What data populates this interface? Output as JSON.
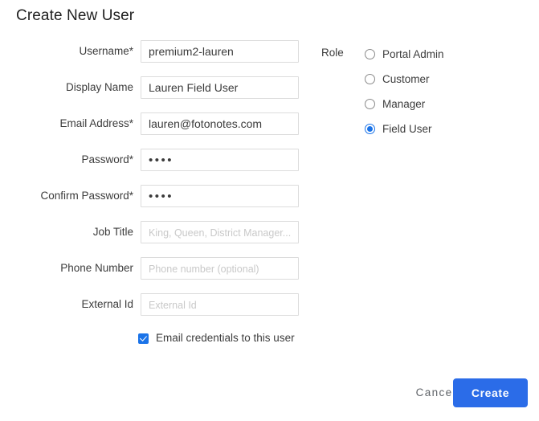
{
  "dialog": {
    "title": "Create New User"
  },
  "form": {
    "fields": [
      {
        "label": "Username*",
        "value": "premium2-lauren",
        "placeholder": "",
        "type": "text",
        "name": "username"
      },
      {
        "label": "Display Name",
        "value": "Lauren Field User",
        "placeholder": "",
        "type": "text",
        "name": "display-name"
      },
      {
        "label": "Email Address*",
        "value": "lauren@fotonotes.com",
        "placeholder": "",
        "type": "text",
        "name": "email-address"
      },
      {
        "label": "Password*",
        "value": "••••",
        "placeholder": "",
        "type": "password",
        "name": "password"
      },
      {
        "label": "Confirm Password*",
        "value": "••••",
        "placeholder": "",
        "type": "password",
        "name": "confirm-password"
      },
      {
        "label": "Job Title",
        "value": "",
        "placeholder": "King, Queen, District Manager...etc.",
        "type": "text",
        "name": "job-title"
      },
      {
        "label": "Phone Number",
        "value": "",
        "placeholder": "Phone number (optional)",
        "type": "text",
        "name": "phone-number"
      },
      {
        "label": "External Id",
        "value": "",
        "placeholder": "External Id",
        "type": "text",
        "name": "external-id"
      }
    ]
  },
  "role": {
    "label": "Role",
    "options": [
      {
        "label": "Portal Admin",
        "selected": false
      },
      {
        "label": "Customer",
        "selected": false
      },
      {
        "label": "Manager",
        "selected": false
      },
      {
        "label": "Field User",
        "selected": true
      }
    ]
  },
  "email_credentials": {
    "label": "Email credentials to this user",
    "checked": true
  },
  "footer": {
    "cancel_label": "Cancel",
    "create_label": "Create"
  },
  "colors": {
    "accent": "#1a73e8",
    "button": "#2b6ce8",
    "border": "#dcdcdc",
    "placeholder": "#c9c9c9",
    "text": "#3c3c3c"
  }
}
